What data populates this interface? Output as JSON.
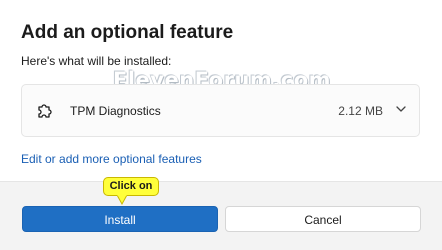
{
  "dialog": {
    "title": "Add an optional feature",
    "subtitle": "Here's what will be installed:"
  },
  "watermark": "ElevenForum.com",
  "feature": {
    "name": "TPM Diagnostics",
    "size": "2.12 MB",
    "icon": "puzzle-icon"
  },
  "link": "Edit or add more optional features",
  "buttons": {
    "install": "Install",
    "cancel": "Cancel"
  },
  "callout": "Click on",
  "colors": {
    "primary": "#1f6fc4",
    "link": "#1a5fb4",
    "callout": "#ffff3a",
    "footer": "#f3f3f3"
  }
}
